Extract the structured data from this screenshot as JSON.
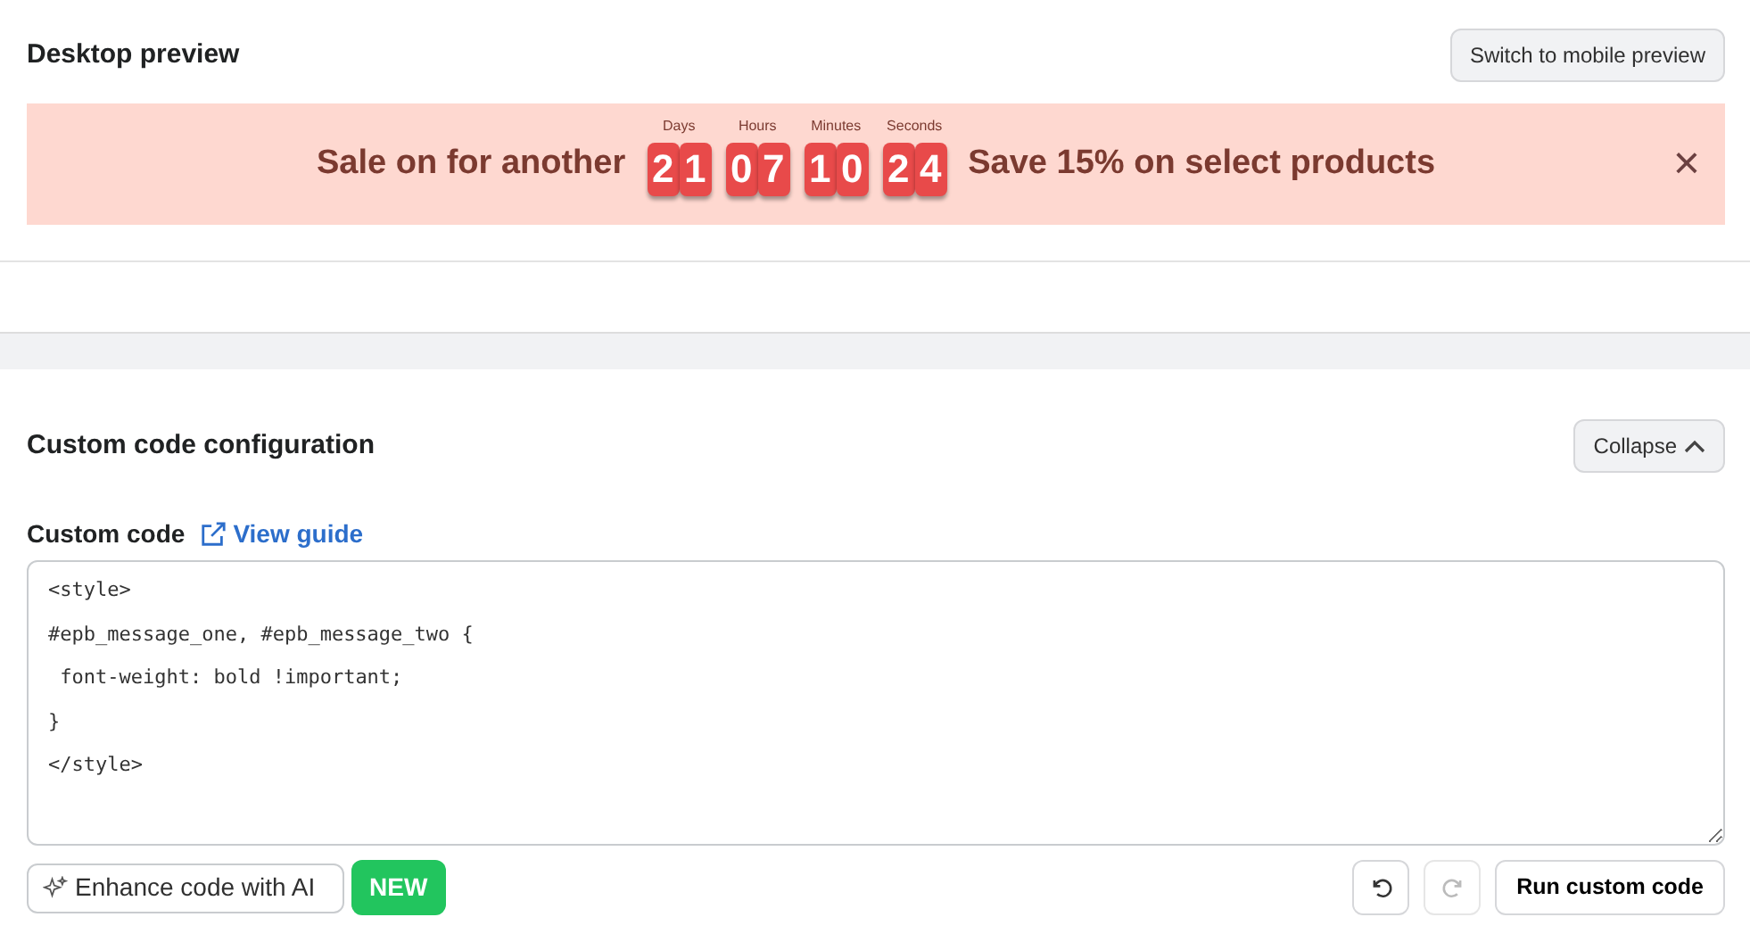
{
  "preview": {
    "title": "Desktop preview",
    "switch_button": "Switch to mobile preview"
  },
  "banner": {
    "lead": "Sale on for another",
    "units": [
      {
        "label": "Days",
        "digits": [
          "2",
          "1"
        ]
      },
      {
        "label": "Hours",
        "digits": [
          "0",
          "7"
        ]
      },
      {
        "label": "Minutes",
        "digits": [
          "1",
          "0"
        ]
      },
      {
        "label": "Seconds",
        "digits": [
          "2",
          "4"
        ]
      }
    ],
    "message": "Save 15% on select products",
    "close": "×"
  },
  "config": {
    "title": "Custom code configuration",
    "collapse_button": "Collapse",
    "field_label": "Custom code",
    "guide_link": "View guide",
    "code": "<style>\n#epb_message_one, #epb_message_two {\n font-weight: bold !important;\n}\n</style>",
    "enhance_button": "Enhance code with AI",
    "new_badge": "NEW",
    "undo_disabled": false,
    "redo_disabled": true,
    "run_button": "Run custom code"
  }
}
